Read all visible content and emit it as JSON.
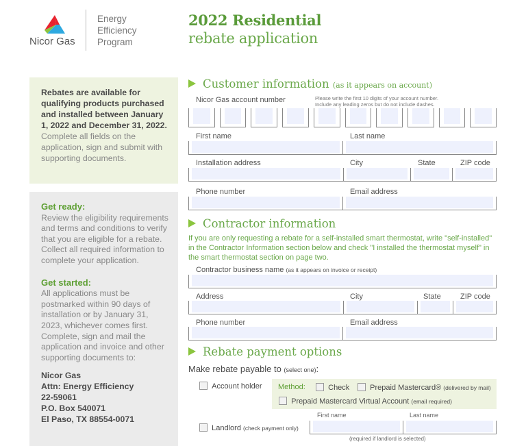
{
  "header": {
    "brand": "Nicor Gas",
    "program_lines": [
      "Energy",
      "Efficiency",
      "Program"
    ],
    "title_line1": "2022 Residential",
    "title_line2": "rebate application",
    "brand_colors": {
      "red": "#e8232f",
      "blue": "#2ea9e0",
      "green": "#8bc53f",
      "title_green": "#5a9b3a"
    }
  },
  "sidebar": {
    "intro_bold": "Rebates are available for qualifying products purchased and installed between January 1, 2022 and December 31, 2022.",
    "intro_rest": " Complete all fields on the application, sign and submit with supporting documents.",
    "get_ready": {
      "heading": "Get ready:",
      "text": "Review the eligibility requirements and terms and conditions to verify that you are eligible for a rebate. Collect all required information to complete your application."
    },
    "get_started": {
      "heading": "Get started:",
      "text": "All applications must be postmarked within 90 days of installation or by January 31, 2023, whichever comes first. Complete, sign and mail the application and invoice and other supporting documents to:"
    },
    "address": [
      "Nicor Gas",
      "Attn: Energy Efficiency",
      "22-59061",
      "P.O. Box 540071",
      "El Paso, TX 88554-0071"
    ]
  },
  "customer": {
    "heading": "Customer information",
    "heading_note": "(as it appears on account)",
    "account_label": "Nicor Gas account number",
    "account_note_1": "Please write the first 10 digits of your account number.",
    "account_note_2": "Include any leading zeros but do not include dashes.",
    "account_digits": [
      "",
      "",
      "",
      "",
      "",
      "",
      "",
      "",
      "",
      ""
    ],
    "first_name_label": "First name",
    "last_name_label": "Last name",
    "address_label": "Installation address",
    "city_label": "City",
    "state_label": "State",
    "zip_label": "ZIP code",
    "phone_label": "Phone number",
    "email_label": "Email address",
    "values": {
      "first_name": "",
      "last_name": "",
      "address": "",
      "city": "",
      "state": "",
      "zip": "",
      "phone": "",
      "email": ""
    }
  },
  "contractor": {
    "heading": "Contractor information",
    "note": "If you are only requesting a rebate for a self-installed smart thermostat, write \"self-installed\" in the Contractor Information section below and check \"I installed the thermostat myself\" in the smart thermostat section on page two.",
    "business_label": "Contractor business name",
    "business_note": "(as it appears on invoice or receipt)",
    "address_label": "Address",
    "city_label": "City",
    "state_label": "State",
    "zip_label": "ZIP code",
    "phone_label": "Phone number",
    "email_label": "Email address"
  },
  "payment": {
    "heading": "Rebate payment options",
    "payable_label": "Make rebate payable to",
    "payable_note": "(select one)",
    "payable_colon": ":",
    "account_holder": "Account holder",
    "method_label": "Method:",
    "check": "Check",
    "prepaid_mc": "Prepaid Mastercard®",
    "prepaid_mc_note": "(delivered by mail)",
    "virtual": "Prepaid Mastercard Virtual Account",
    "virtual_note": "(email required)",
    "landlord": "Landlord",
    "landlord_note": "(check payment only)",
    "ll_first": "First name",
    "ll_last": "Last name",
    "ll_required": "(required if landlord is selected)",
    "checked": {
      "account_holder": false,
      "check": false,
      "prepaid_mc": false,
      "virtual": false,
      "landlord": false
    }
  }
}
